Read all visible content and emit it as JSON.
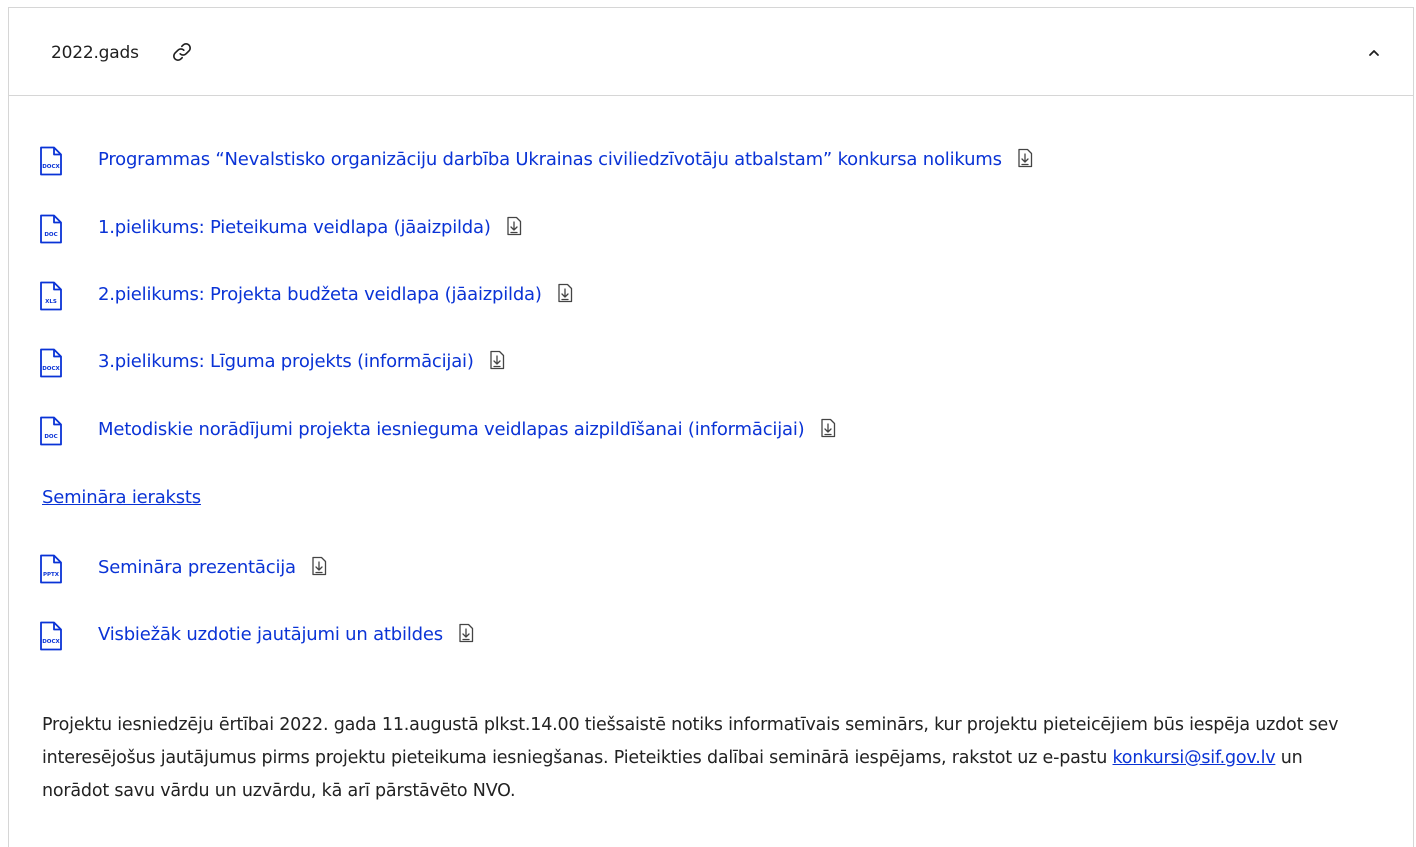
{
  "section": {
    "title": "2022.gads"
  },
  "documents": [
    {
      "type": "DOCX",
      "label": "Programmas “Nevalstisko organizāciju darbība Ukrainas civiliedzīvotāju atbalstam” konkursa nolikums"
    },
    {
      "type": "DOC",
      "label": "1.pielikums: Pieteikuma veidlapa (jāaizpilda)"
    },
    {
      "type": "XLS",
      "label": "2.pielikums: Projekta budžeta veidlapa (jāaizpilda)"
    },
    {
      "type": "DOCX",
      "label": "3.pielikums: Līguma projekts (informācijai)"
    },
    {
      "type": "DOC",
      "label": "Metodiskie norādījumi projekta iesnieguma veidlapas aizpildīšanai (informācijai)"
    }
  ],
  "seminar_recording": "Semināra ieraksts",
  "documents2": [
    {
      "type": "PPTX",
      "label": "Semināra prezentācija"
    },
    {
      "type": "DOCX",
      "label": "Visbiežāk uzdotie jautājumi un atbildes"
    }
  ],
  "info": {
    "text_before": "Projektu iesniedzēju ērtībai 2022. gada 11.augustā plkst.14.00 tiešsaistē notiks informatīvais seminārs, kur projektu pieteicējiem būs iespēja uzdot sev interesējošus jautājumus pirms projektu pieteikuma iesniegšanas. Pieteikties dalībai seminārā iespējams, rakstot uz e-pastu ",
    "email": "konkursi@sif.gov.lv",
    "text_after": "  un norādot savu vārdu un uzvārdu, kā arī pārstāvēto NVO."
  },
  "colors": {
    "link": "#0a33d6",
    "border": "#d6d6d6",
    "text": "#222222"
  }
}
